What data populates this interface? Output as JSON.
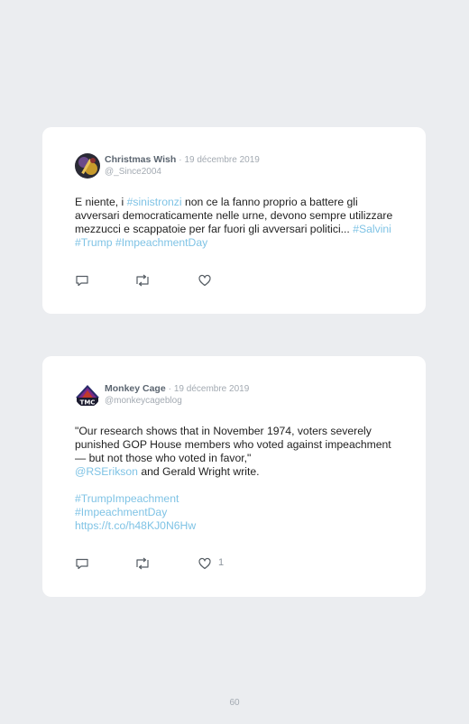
{
  "tweets": [
    {
      "name": "Christmas Wish",
      "separator": "·",
      "date": "19 décembre 2019",
      "handle": "@_Since2004",
      "text_1": "E niente, i ",
      "tag_1": "#sinistronzi",
      "text_2": " non ce la fanno proprio a battere gli avversari democraticamente nelle urne, devono sempre utilizzare mezzucci e scappatoie per far fuori gli avversari politici... ",
      "tag_2": "#Salvini",
      "space": " ",
      "tag_3": "#Trump",
      "tag_4": "#ImpeachmentDay"
    },
    {
      "name": "Monkey Cage",
      "separator": "·",
      "date": "19 décembre 2019",
      "handle": "@monkeycageblog",
      "text_1": "\"Our research shows that in November 1974, voters severely punished GOP House members who voted against impeachment — but not those who voted in favor,\"",
      "mention": "@RSErikson",
      "text_2": " and Gerald Wright write.",
      "tag_1": "#TrumpImpeachment",
      "tag_2": "#ImpeachmentDay",
      "url": "https://t.co/h48KJ0N6Hw",
      "likes": "1"
    }
  ],
  "page_number": "60",
  "colors": {
    "link": "#7fc3e5",
    "background": "#ebedf0",
    "card": "#ffffff"
  },
  "icons": [
    "reply-icon",
    "retweet-icon",
    "heart-icon"
  ]
}
